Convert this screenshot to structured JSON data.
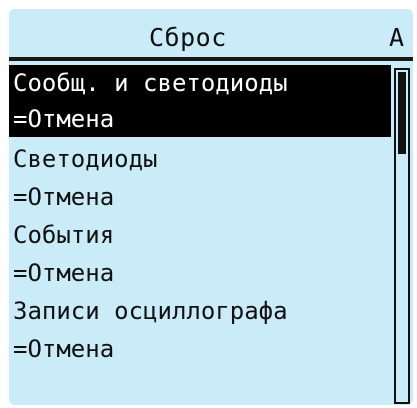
{
  "header": {
    "title": "Сброс",
    "access_level": "A"
  },
  "items": [
    {
      "label": "Сообщ. и светодиоды",
      "selected": true
    },
    {
      "label": "=Отмена",
      "selected": true
    },
    {
      "label": "Светодиоды",
      "selected": false
    },
    {
      "label": "=Отмена",
      "selected": false
    },
    {
      "label": "События",
      "selected": false
    },
    {
      "label": "=Отмена",
      "selected": false
    },
    {
      "label": "Записи осциллографа",
      "selected": false
    },
    {
      "label": "=Отмена",
      "selected": false
    }
  ],
  "scrollbar": {
    "position_fraction": 0.0,
    "visible_fraction": 0.25
  },
  "colors": {
    "screen_background": "#c9ecf8",
    "selection": "#000000",
    "text": "#111111"
  }
}
